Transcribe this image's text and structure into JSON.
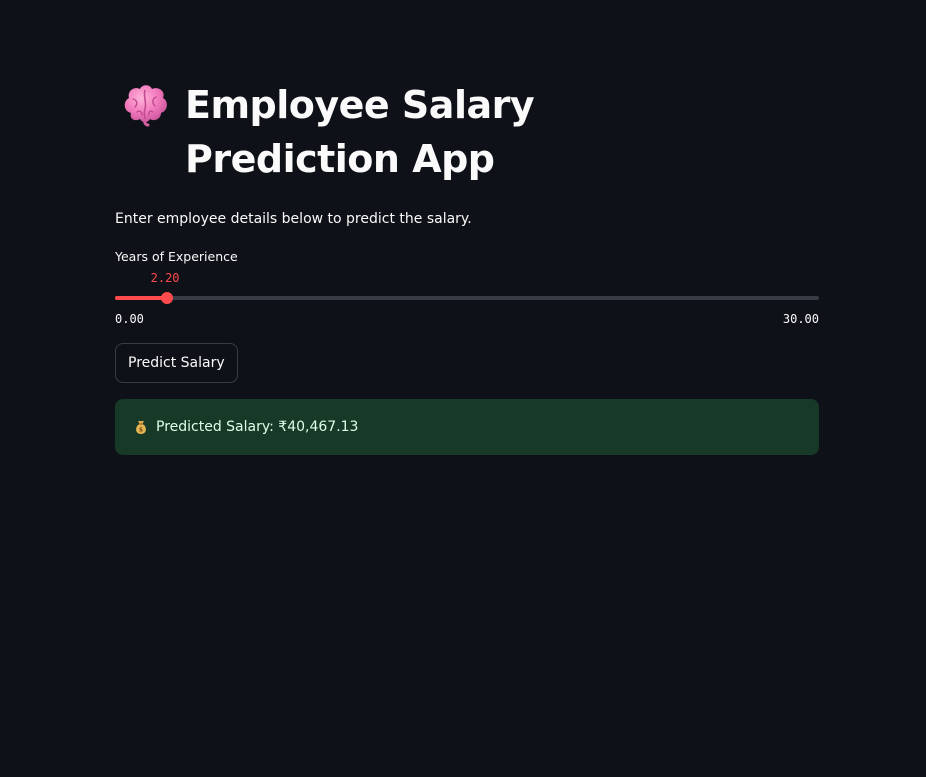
{
  "page": {
    "title": "Employee Salary Prediction App",
    "title_icon": "brain-icon",
    "subtitle": "Enter employee details below to predict the salary."
  },
  "slider": {
    "label": "Years of Experience",
    "value": 2.2,
    "value_label": "2.20",
    "min": 0,
    "max": 30,
    "min_label": "0.00",
    "max_label": "30.00",
    "accent_color": "#ff4b4b"
  },
  "predict_button": {
    "label": "Predict Salary"
  },
  "result": {
    "icon": "moneybag-icon",
    "text": "Predicted Salary: ₹40,467.13",
    "background_color": "#173928"
  }
}
